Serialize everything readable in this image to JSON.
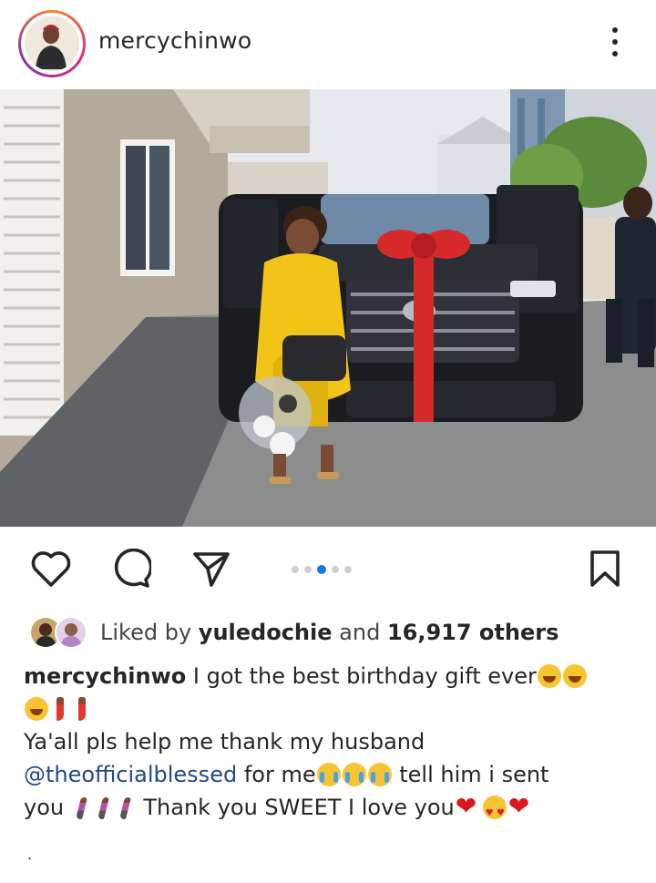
{
  "post": {
    "username": "mercychinwo",
    "header_icons": [
      "more-options-icon"
    ],
    "actions": [
      "heart-icon",
      "comment-icon",
      "share-icon",
      "bookmark-icon"
    ],
    "carousel": {
      "count": 5,
      "active_index": 2
    },
    "likes": {
      "prefix": "Liked by",
      "user": "yuledochie",
      "middle": "and",
      "count": "16,917 others"
    },
    "caption": {
      "username": "mercychinwo",
      "line1": "I got the best birthday gift ever",
      "line2": "Ya'all pls help me thank my husband",
      "mention": "@theofficialblessed",
      "part3a": "for me",
      "part3b": "tell him i sent",
      "part4a": "you",
      "part4b": "Thank you SWEET I love you",
      "trailing": "."
    },
    "colors": {
      "accent": "#1877f2",
      "mention": "#234a82",
      "ribbon": "#d62a2a",
      "dress": "#f2c417"
    }
  }
}
